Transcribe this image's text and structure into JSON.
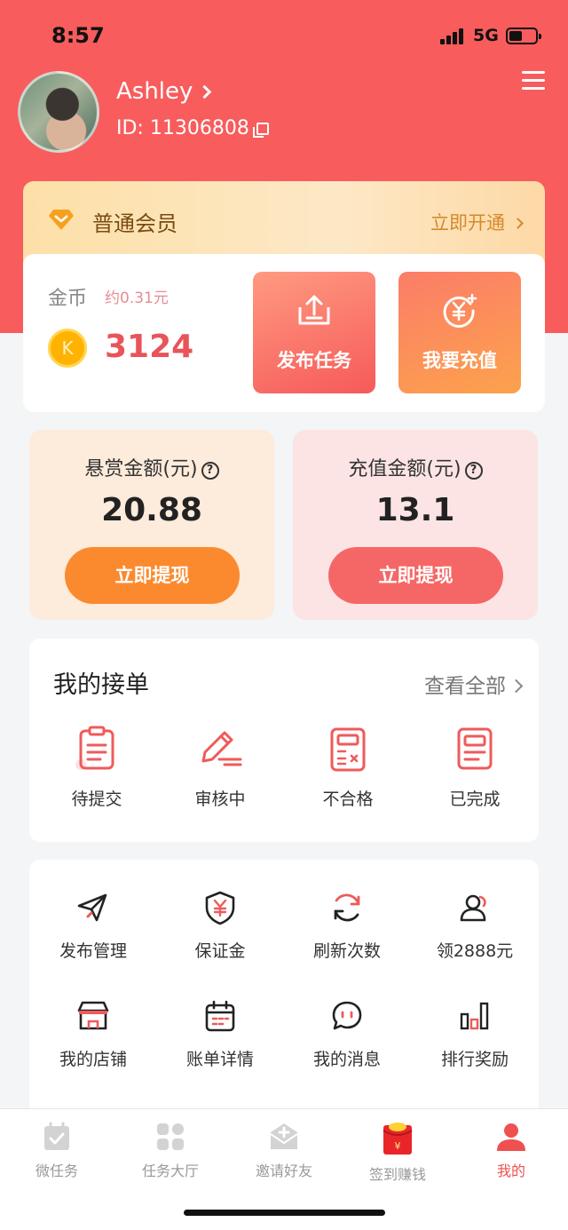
{
  "status_bar": {
    "time": "8:57",
    "network": "5G"
  },
  "profile": {
    "name": "Ashley",
    "id_text": "ID: 11306808"
  },
  "member": {
    "title": "普通会员",
    "action": "立即开通"
  },
  "coins": {
    "label": "金币",
    "approx": "约0.31元",
    "coin_glyph": "K",
    "value": "3124"
  },
  "actions": {
    "publish": "发布任务",
    "recharge": "我要充值"
  },
  "amounts": {
    "reward": {
      "title": "悬赏金额(元)",
      "value": "20.88",
      "button": "立即提现"
    },
    "recharge": {
      "title": "充值金额(元)",
      "value": "13.1",
      "button": "立即提现"
    }
  },
  "orders": {
    "title": "我的接单",
    "view_all": "查看全部",
    "items": [
      {
        "label": "待提交",
        "icon": "clipboard-icon"
      },
      {
        "label": "审核中",
        "icon": "pencil-icon"
      },
      {
        "label": "不合格",
        "icon": "calculator-icon"
      },
      {
        "label": "已完成",
        "icon": "document-icon"
      }
    ]
  },
  "tools": [
    {
      "label": "发布管理",
      "icon": "paper-plane-icon"
    },
    {
      "label": "保证金",
      "icon": "shield-yen-icon"
    },
    {
      "label": "刷新次数",
      "icon": "refresh-icon"
    },
    {
      "label": "领2888元",
      "icon": "user-icon"
    },
    {
      "label": "我的店铺",
      "icon": "store-icon"
    },
    {
      "label": "账单详情",
      "icon": "calendar-icon"
    },
    {
      "label": "我的消息",
      "icon": "chat-icon"
    },
    {
      "label": "排行奖励",
      "icon": "bar-chart-icon"
    }
  ],
  "tabs": [
    {
      "label": "微任务",
      "icon": "task-icon"
    },
    {
      "label": "任务大厅",
      "icon": "grid-icon"
    },
    {
      "label": "邀请好友",
      "icon": "invite-icon"
    },
    {
      "label": "签到赚钱",
      "icon": "red-envelope-icon"
    },
    {
      "label": "我的",
      "icon": "profile-icon",
      "active": true
    }
  ],
  "colors": {
    "brand_red": "#f85c5c",
    "accent_orange": "#fb8a2f",
    "active_tab": "#f05050"
  }
}
